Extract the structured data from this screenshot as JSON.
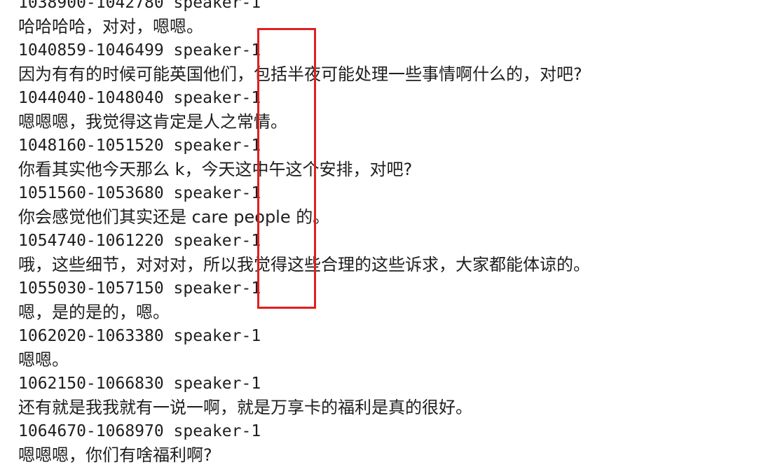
{
  "transcript": [
    {
      "header": "1038900-1042780 speaker-1",
      "text": "哈哈哈哈，对对，嗯嗯。"
    },
    {
      "header": "1040859-1046499 speaker-1",
      "text": "因为有有的时候可能英国他们，包括半夜可能处理一些事情啊什么的，对吧?"
    },
    {
      "header": "1044040-1048040 speaker-1",
      "text": "嗯嗯嗯，我觉得这肯定是人之常情。"
    },
    {
      "header": "1048160-1051520 speaker-1",
      "text": "你看其实他今天那么 k，今天这中午这个安排，对吧?"
    },
    {
      "header": "1051560-1053680 speaker-1",
      "text": "你会感觉他们其实还是 care people 的。"
    },
    {
      "header": "1054740-1061220 speaker-1",
      "text": "哦，这些细节，对对对，所以我觉得这些合理的这些诉求，大家都能体谅的。"
    },
    {
      "header": "1055030-1057150 speaker-1",
      "text": "嗯，是的是的，嗯。"
    },
    {
      "header": "1062020-1063380 speaker-1",
      "text": "嗯嗯。"
    },
    {
      "header": "1062150-1066830 speaker-1",
      "text": "还有就是我我就有一说一啊，就是万享卡的福利是真的很好。"
    },
    {
      "header": "1064670-1068970 speaker-1",
      "text": "嗯嗯嗯，你们有啥福利啊?"
    }
  ],
  "colors": {
    "text": "#1e1e1e",
    "highlight": "#e02020",
    "background": "#ffffff"
  }
}
